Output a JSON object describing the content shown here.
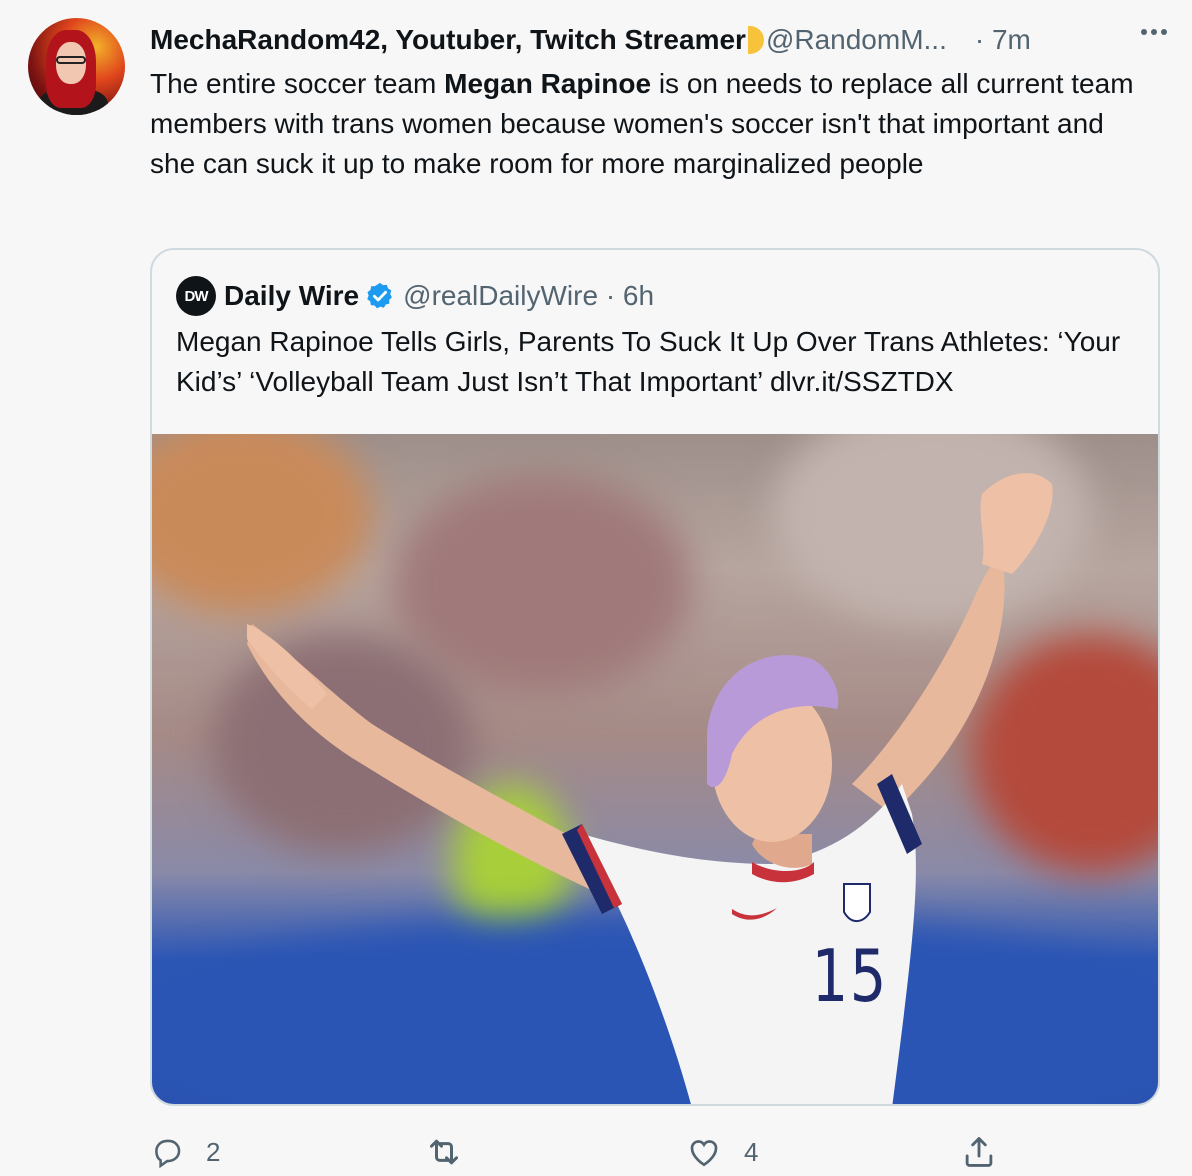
{
  "author": {
    "display_name": "MechaRandom42, Youtuber, Twitch Streamer",
    "handle": "@RandomM...",
    "time": "· 7m"
  },
  "tweet": {
    "text_before": "The entire soccer team ",
    "text_bold": "Megan Rapinoe",
    "text_after": " is on needs to replace all current team members with trans women because women's soccer isn't that important and she can suck it up to make room for more marginalized people"
  },
  "quote": {
    "logo_text": "DW",
    "name": "Daily Wire",
    "handle_time": "@realDailyWire · 6h",
    "text": "Megan Rapinoe Tells Girls, Parents To Suck It Up Over Trans Athletes: ‘Your Kid’s’ ‘Volleyball Team Just Isn’t That Important’ dlvr.it/SSZTDX",
    "jersey_number": "15"
  },
  "actions": {
    "reply_count": "2",
    "retweet_count": "",
    "like_count": "4"
  },
  "icons": {
    "more": "more-horizontal-icon",
    "verified": "verified-badge-icon",
    "reply": "reply-icon",
    "retweet": "retweet-icon",
    "like": "heart-icon",
    "share": "share-icon"
  },
  "colors": {
    "text": "#0f1419",
    "secondary": "#536471",
    "verified": "#1d9bf0",
    "border": "#cfd9de"
  }
}
